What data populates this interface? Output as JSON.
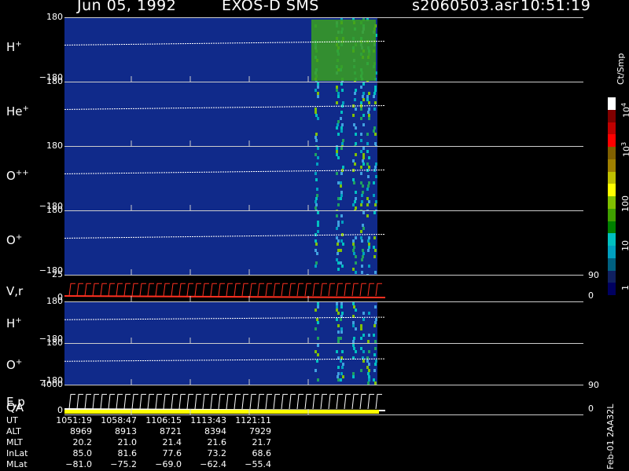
{
  "header": {
    "date": "Jun 05, 1992",
    "mission": "EXOS-D SMS",
    "file": "s2060503.asr",
    "time": "10:51:19"
  },
  "panels": [
    {
      "label": "H",
      "sup": "+",
      "ytop": "180",
      "ybot": "−180",
      "type": "spectrogram"
    },
    {
      "label": "He",
      "sup": "+",
      "ytop": "180",
      "ybot": "",
      "type": "spectrogram"
    },
    {
      "label": "O",
      "sup": "++",
      "ytop": "180",
      "ybot": "−180",
      "type": "spectrogram"
    },
    {
      "label": "O",
      "sup": "+",
      "ytop": "180",
      "ybot": "−180",
      "type": "spectrogram"
    },
    {
      "label": "V,r",
      "sup": "",
      "ytop": "25",
      "ybot": "0",
      "type": "line",
      "rtop": "90",
      "rbot": "0"
    },
    {
      "label": "H",
      "sup": "+",
      "ytop": "180",
      "ybot": "−180",
      "type": "spectrogram"
    },
    {
      "label": "O",
      "sup": "+",
      "ytop": "180",
      "ybot": "−180",
      "type": "spectrogram"
    },
    {
      "label": "E,p",
      "sup": "",
      "label2": "QA",
      "ytop": "4000",
      "ybot": "0",
      "type": "line",
      "rtop": "90",
      "rbot": "0"
    }
  ],
  "colorbar": {
    "unit": "Ct/Smp",
    "labels": [
      "10",
      "10",
      "100",
      "10",
      "1"
    ],
    "label_sups": [
      "4",
      "3",
      "",
      "",
      ""
    ],
    "colors": [
      "#ffffff",
      "#800000",
      "#c00000",
      "#ff0000",
      "#806000",
      "#a08000",
      "#c0c000",
      "#ffff00",
      "#80c000",
      "#40a000",
      "#008000",
      "#00c0c0",
      "#00a0c0",
      "#006080",
      "#102060",
      "#000060"
    ]
  },
  "time_table": {
    "rows": [
      {
        "label": "UT",
        "values": [
          "1051:19",
          "1058:47",
          "1106:15",
          "1113:43",
          "1121:11"
        ]
      },
      {
        "label": "ALT",
        "values": [
          "8969",
          "8913",
          "8721",
          "8394",
          "7929"
        ]
      },
      {
        "label": "MLT",
        "values": [
          "20.2",
          "21.0",
          "21.4",
          "21.6",
          "21.7"
        ]
      },
      {
        "label": "InLat",
        "values": [
          "85.0",
          "81.6",
          "77.6",
          "73.2",
          "68.6"
        ]
      },
      {
        "label": "MLat",
        "values": [
          "−81.0",
          "−75.2",
          "−69.0",
          "−62.4",
          "−55.4"
        ]
      }
    ]
  },
  "footer_id": "Feb-01 2AA32L",
  "chart_data": {
    "type": "heatmap",
    "title": "Jun 05, 1992   EXOS-D SMS",
    "x": [
      "1051:19",
      "1058:47",
      "1106:15",
      "1113:43",
      "1121:11"
    ],
    "ylim": [
      -180,
      180
    ],
    "color_scale": {
      "unit": "Ct/Smp",
      "log": true,
      "range": [
        1,
        10000
      ]
    },
    "grid": true
  }
}
